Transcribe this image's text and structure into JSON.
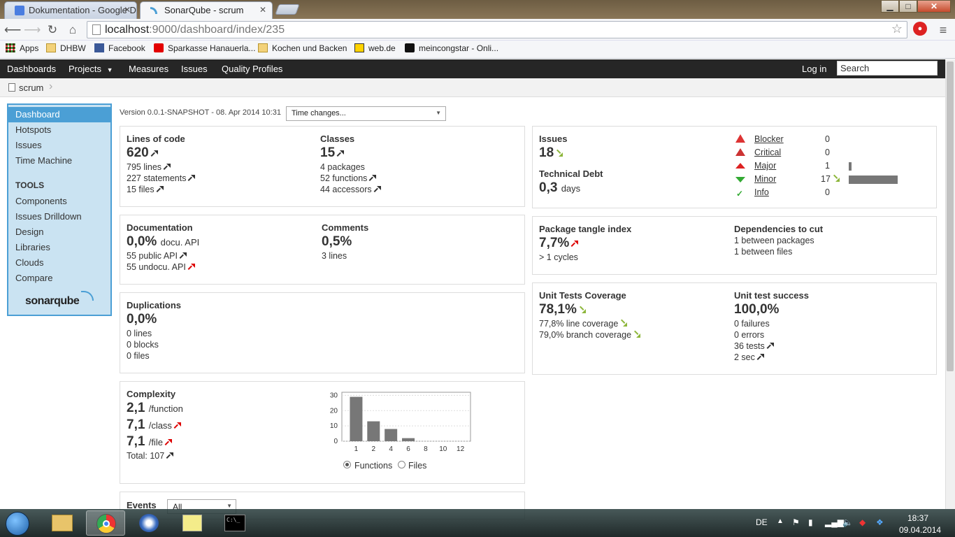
{
  "browser": {
    "tabs": [
      {
        "label": "Dokumentation - Google D",
        "active": false
      },
      {
        "label": "SonarQube - scrum",
        "active": true
      }
    ],
    "window_controls": {
      "minimize": "▁",
      "maximize": "□",
      "close": "✕"
    },
    "url_host": "localhost",
    "url_rest": ":9000/dashboard/index/235",
    "bookmarks": [
      {
        "label": "Apps",
        "icon": "apps-grid-icon"
      },
      {
        "label": "DHBW",
        "icon": "folder-icon"
      },
      {
        "label": "Facebook",
        "icon": "facebook-icon"
      },
      {
        "label": "Sparkasse Hanauerla...",
        "icon": "sparkasse-icon"
      },
      {
        "label": "Kochen und Backen",
        "icon": "folder-icon"
      },
      {
        "label": "web.de",
        "icon": "webde-icon"
      },
      {
        "label": "meincongstar - Onli...",
        "icon": "congstar-icon"
      }
    ]
  },
  "sonar": {
    "nav": {
      "dashboards": "Dashboards",
      "projects": "Projects",
      "measures": "Measures",
      "issues": "Issues",
      "quality_profiles": "Quality Profiles",
      "login": "Log in",
      "search_placeholder": "Search"
    },
    "breadcrumb": "scrum",
    "sidebar": {
      "items": [
        "Dashboard",
        "Hotspots",
        "Issues",
        "Time Machine"
      ],
      "tools_title": "TOOLS",
      "tools": [
        "Components",
        "Issues Drilldown",
        "Design",
        "Libraries",
        "Clouds",
        "Compare"
      ],
      "logo": "sonarqube"
    },
    "version": "Version 0.0.1-SNAPSHOT - 08. Apr 2014 10:31",
    "time_changes": "Time changes...",
    "size": {
      "loc_label": "Lines of code",
      "loc": "620",
      "lines": "795 lines",
      "statements": "227 statements",
      "files": "15 files",
      "classes_label": "Classes",
      "classes": "15",
      "packages": "4 packages",
      "functions": "52 functions",
      "accessors": "44 accessors"
    },
    "doc": {
      "label": "Documentation",
      "value": "0,0%",
      "unit": "docu. API",
      "public_api": "55 public API",
      "undoc_api": "55 undocu. API",
      "comments_label": "Comments",
      "comments": "0,5%",
      "comment_lines": "3 lines"
    },
    "dup": {
      "label": "Duplications",
      "value": "0,0%",
      "lines": "0 lines",
      "blocks": "0 blocks",
      "files": "0 files"
    },
    "complexity": {
      "label": "Complexity",
      "function": "2,1",
      "function_unit": "/function",
      "class": "7,1",
      "class_unit": "/class",
      "file": "7,1",
      "file_unit": "/file",
      "total": "Total: 107",
      "radio_functions": "Functions",
      "radio_files": "Files"
    },
    "events": {
      "label": "Events",
      "filter": "All"
    },
    "issues": {
      "label": "Issues",
      "value": "18",
      "debt_label": "Technical Debt",
      "debt": "0,3",
      "debt_unit": "days",
      "severities": [
        {
          "name": "Blocker",
          "count": "0",
          "icon": "blocker-icon"
        },
        {
          "name": "Critical",
          "count": "0",
          "icon": "critical-icon"
        },
        {
          "name": "Major",
          "count": "1",
          "icon": "major-icon"
        },
        {
          "name": "Minor",
          "count": "17",
          "icon": "minor-icon"
        },
        {
          "name": "Info",
          "count": "0",
          "icon": "info-icon"
        }
      ]
    },
    "tangle": {
      "label": "Package tangle index",
      "value": "7,7%",
      "cycles": "> 1 cycles",
      "deps_label": "Dependencies to cut",
      "between_packages": "1 between packages",
      "between_files": "1 between files"
    },
    "tests": {
      "coverage_label": "Unit Tests Coverage",
      "coverage": "78,1%",
      "line_coverage": "77,8% line coverage",
      "branch_coverage": "79,0% branch coverage",
      "success_label": "Unit test success",
      "success": "100,0%",
      "failures": "0 failures",
      "errors": "0 errors",
      "tests": "36 tests",
      "duration": "2 sec"
    }
  },
  "chart_data": {
    "type": "bar",
    "categories": [
      "1",
      "2",
      "4",
      "6",
      "8",
      "10",
      "12"
    ],
    "values": [
      29,
      13,
      8,
      2,
      0,
      0,
      0
    ],
    "ylim": [
      0,
      32
    ],
    "yticks": [
      "30",
      "20",
      "10",
      "0"
    ],
    "grid": true
  },
  "taskbar": {
    "lang": "DE",
    "time": "18:37",
    "date": "09.04.2014"
  }
}
